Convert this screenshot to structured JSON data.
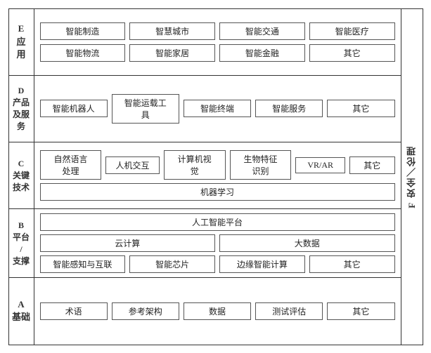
{
  "sections": {
    "E": {
      "label": "E\n应\n用",
      "rows": [
        [
          "智能制造",
          "智慧城市",
          "智能交通",
          "智能医疗"
        ],
        [
          "智能物流",
          "智能家居",
          "智能金融",
          "其它"
        ]
      ]
    },
    "D": {
      "label": "D\n产品\n及服\n务",
      "row": [
        "智能机器人",
        "智能运载工具",
        "智能终端",
        "智能服务",
        "其它"
      ]
    },
    "C": {
      "label": "C\n关键\n技术",
      "row1": [
        "自然语言处理",
        "人机交互",
        "计算机视觉",
        "生物特征识别",
        "VR/AR",
        "其它"
      ],
      "row2": "机器学习"
    },
    "B": {
      "label": "B\n平台\n/\n支撑",
      "row1": "人工智能平台",
      "row2": [
        "云计算",
        "大数据"
      ],
      "row3": [
        "智能感知与互联",
        "智能芯片",
        "边缘智能计算",
        "其它"
      ]
    },
    "A": {
      "label": "A\n基础",
      "row": [
        "术语",
        "参考架构",
        "数据",
        "测试评估",
        "其它"
      ]
    }
  },
  "f_label": "F 安全／伦理"
}
